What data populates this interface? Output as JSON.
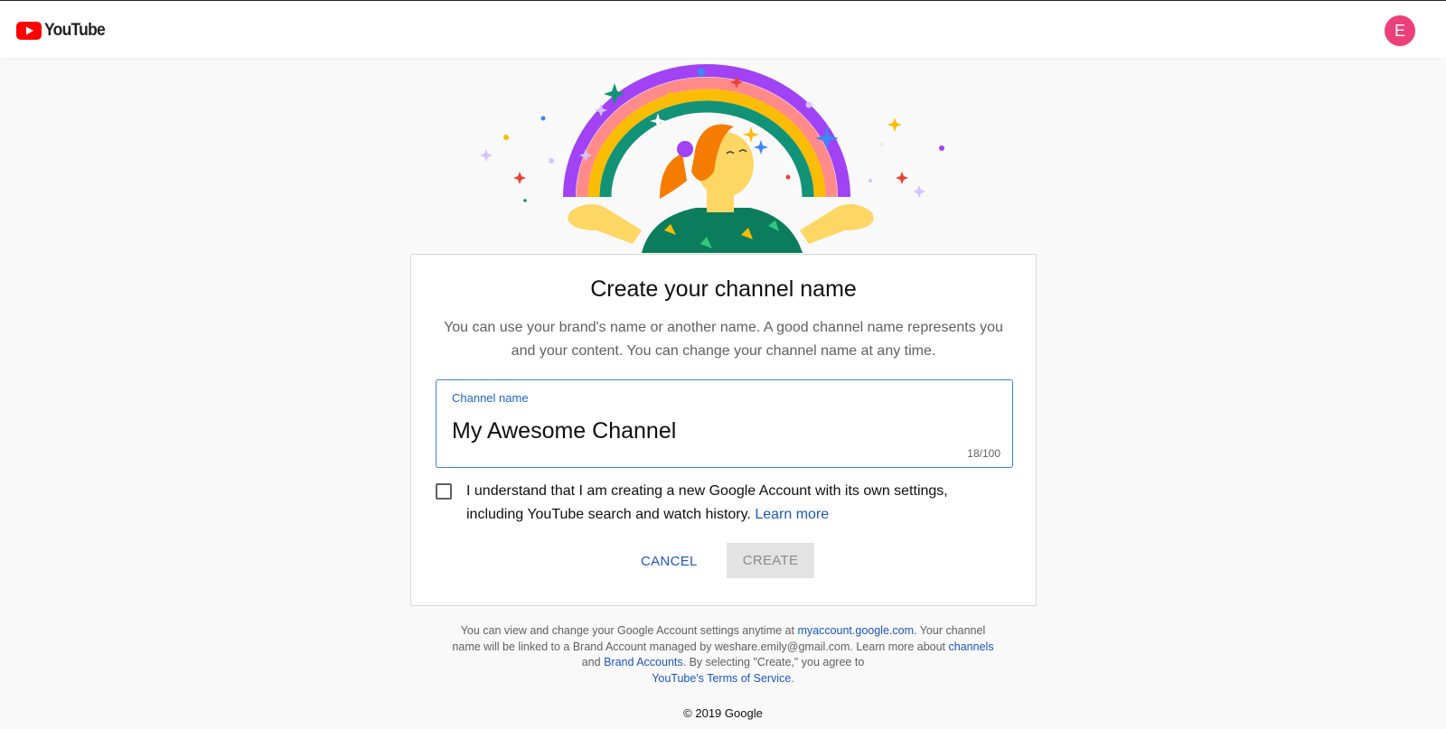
{
  "header": {
    "logo_text": "YouTube",
    "avatar_letter": "E",
    "avatar_color": "#ec407a"
  },
  "card": {
    "title": "Create your channel name",
    "description": "You can use your brand's name or another name. A good channel name represents you and your content. You can change your channel name at any time.",
    "field": {
      "label": "Channel name",
      "value": "My Awesome Channel",
      "counter": "18/100"
    },
    "consent": {
      "checked": false,
      "text": "I understand that I am creating a new Google Account with its own settings, including YouTube search and watch history.",
      "link": "Learn more"
    },
    "buttons": {
      "cancel": "CANCEL",
      "create": "CREATE"
    }
  },
  "footer": {
    "part1": "You can view and change your Google Account settings anytime at",
    "link_account": "myaccount.google.com",
    "part2": ". Your channel name will be linked to a Brand Account managed by weshare.emily@gmail.com. Learn more about",
    "link_channels": "channels",
    "part3": "and",
    "link_brand": "Brand Accounts",
    "part4": ". By selecting \"Create,\" you agree to",
    "link_terms": "YouTube's Terms of Service",
    "part5": ".",
    "copyright": "© 2019 Google"
  },
  "colors": {
    "accent": "#1a56c4",
    "focus_border": "#3f7ee8",
    "brand_red": "#ff0000"
  },
  "icons": [
    "youtube-logo-icon",
    "checkbox-icon",
    "rainbow-illustration"
  ]
}
